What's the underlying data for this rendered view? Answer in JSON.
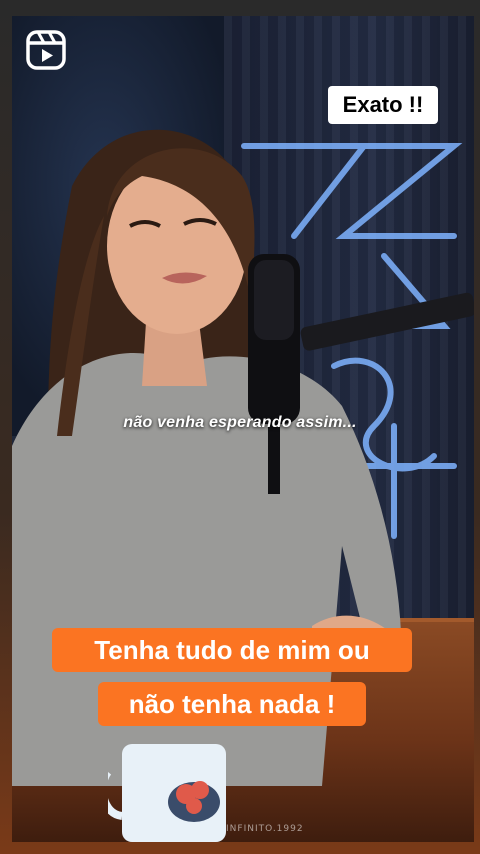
{
  "viewer": {
    "reels_icon": "reels-icon",
    "sticker_text": "Exato !!",
    "subtitle_text": "não venha esperando assim...",
    "caption_line1": "Tenha tudo de mim ou",
    "caption_line2": "não tenha nada !",
    "watermark_text": "INFINITO.1992"
  },
  "colors": {
    "caption_bg": "#fb7422",
    "sticker_bg": "#ffffff",
    "neon": "#7fb3ff"
  }
}
